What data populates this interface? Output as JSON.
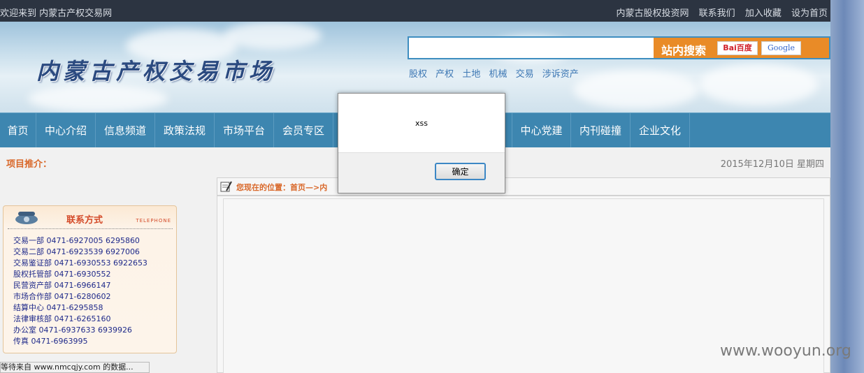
{
  "topbar": {
    "welcome": "欢迎来到 内蒙古产权交易网",
    "links": [
      "内蒙古股权投资网",
      "联系我们",
      "加入收藏",
      "设为首页"
    ]
  },
  "header": {
    "logo_text": "内蒙古产权交易市场",
    "search": {
      "placeholder": "",
      "label": "站内搜索",
      "baidu_label": "Bai百度",
      "google_label": "Google"
    },
    "hot_links": [
      "股权",
      "产权",
      "土地",
      "机械",
      "交易",
      "涉诉资产"
    ]
  },
  "nav": {
    "items": [
      "首页",
      "中心介绍",
      "信息频道",
      "政策法规",
      "市场平台",
      "会员专区",
      "",
      "",
      "",
      "中心党建",
      "内刊碰撞",
      "企业文化"
    ]
  },
  "content": {
    "promo_label": "项目推介：",
    "date": "2015年12月10日 星期四",
    "location": "您现在的位置：首页—>内"
  },
  "contact": {
    "title": "联系方式",
    "title_en": "TELEPHONE",
    "rows": [
      "交易一部  0471-6927005   6295860",
      "交易二部  0471-6923539   6927006",
      "交易鉴证部  0471-6930553   6922653",
      "股权托管部  0471-6930552",
      "民营资产部  0471-6966147",
      "市场合作部  0471-6280602",
      "结算中心   0471-6295858",
      "法律审核部  0471-6265160",
      "办公室  0471-6937633   6939926",
      "传真  0471-6963995"
    ]
  },
  "statusbar": {
    "text": "等待来自 www.nmcqjy.com 的数据..."
  },
  "alert": {
    "message": "xss",
    "ok_label": "确定"
  },
  "watermark": "www.wooyun.org",
  "colors": {
    "topbar": "#2c3441",
    "nav": "#3d86b0",
    "search_accent": "#e98b27",
    "promo": "#d9682a"
  }
}
